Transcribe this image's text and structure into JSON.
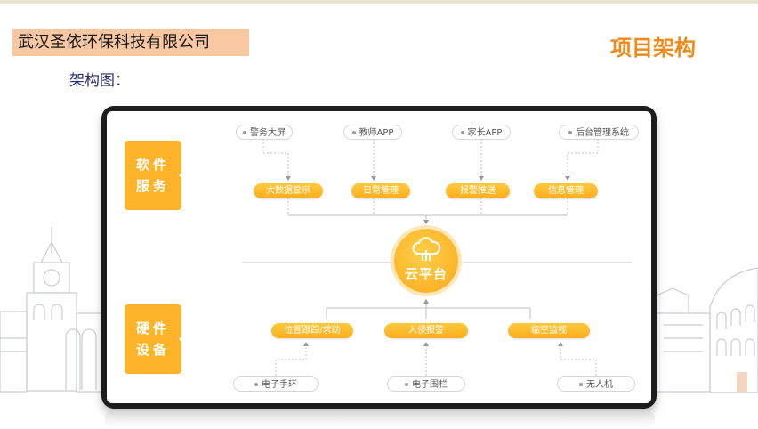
{
  "header": {
    "company": "武汉圣依环保科技有限公司",
    "title": "项目架构",
    "subtitle": "架构图："
  },
  "diagram": {
    "software_label": "软件服务",
    "hardware_label": "硬件设备",
    "software_clients": [
      "警务大屏",
      "教师APP",
      "家长APP",
      "后台管理系统"
    ],
    "software_modules": [
      "大数据显示",
      "日常管理",
      "报警推送",
      "信息管理"
    ],
    "core": "云平台",
    "hardware_modules": [
      "位置跟踪/求助",
      "入侵报警",
      "临空监视"
    ],
    "hardware_devices": [
      "电子手环",
      "电子围栏",
      "无人机"
    ]
  },
  "colors": {
    "accent": "#fdb32a",
    "title": "#f08a1a",
    "company_bg": "#f9c8a3",
    "subtitle": "#2a2f6a"
  }
}
